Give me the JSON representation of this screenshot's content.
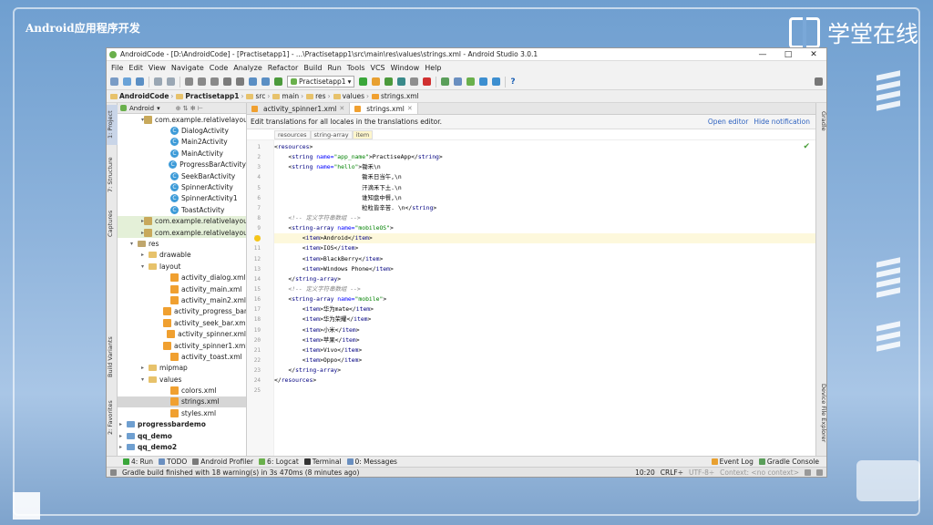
{
  "slide": {
    "title": "Android应用程序开发",
    "brand": "学堂在线"
  },
  "window": {
    "title": "AndroidCode - [D:\\AndroidCode] - [Practisetapp1] - ...\\Practisetapp1\\src\\main\\res\\values\\strings.xml - Android Studio 3.0.1",
    "minimize": "—",
    "maximize": "□",
    "close": "✕"
  },
  "menu": [
    "File",
    "Edit",
    "View",
    "Navigate",
    "Code",
    "Analyze",
    "Refactor",
    "Build",
    "Run",
    "Tools",
    "VCS",
    "Window",
    "Help"
  ],
  "toolbar": {
    "run_config": "Practisetapp1",
    "help": "?"
  },
  "breadcrumb": [
    "AndroidCode",
    "Practisetapp1",
    "src",
    "main",
    "res",
    "values",
    "strings.xml"
  ],
  "project_panel": {
    "view": "Android",
    "icons": "⊕ ⇅ ✻ ⊢"
  },
  "left_tabs": [
    "1: Project",
    "7: Structure",
    "Captures",
    "Build Variants",
    "2: Favorites"
  ],
  "right_tabs": [
    "Gradle",
    "Device File Explorer"
  ],
  "tree": [
    {
      "label": "com.example.relativelayou",
      "depth": 1,
      "kind": "pkg",
      "arrow": "▾"
    },
    {
      "label": "DialogActivity",
      "depth": 3,
      "kind": "cls"
    },
    {
      "label": "Main2Activity",
      "depth": 3,
      "kind": "cls"
    },
    {
      "label": "MainActivity",
      "depth": 3,
      "kind": "cls"
    },
    {
      "label": "ProgressBarActivity",
      "depth": 3,
      "kind": "cls"
    },
    {
      "label": "SeekBarActivity",
      "depth": 3,
      "kind": "cls"
    },
    {
      "label": "SpinnerActivity",
      "depth": 3,
      "kind": "cls"
    },
    {
      "label": "SpinnerActivity1",
      "depth": 3,
      "kind": "cls"
    },
    {
      "label": "ToastActivity",
      "depth": 3,
      "kind": "cls"
    },
    {
      "label": "com.example.relativelayou",
      "depth": 1,
      "kind": "pkg",
      "arrow": "▸",
      "hl": true
    },
    {
      "label": "com.example.relativelayou",
      "depth": 1,
      "kind": "pkg",
      "arrow": "▸",
      "hl": true
    },
    {
      "label": "res",
      "depth": 0,
      "kind": "res",
      "arrow": "▾"
    },
    {
      "label": "drawable",
      "depth": 1,
      "kind": "fld",
      "arrow": "▸"
    },
    {
      "label": "layout",
      "depth": 1,
      "kind": "fld",
      "arrow": "▾"
    },
    {
      "label": "activity_dialog.xml",
      "depth": 3,
      "kind": "xml"
    },
    {
      "label": "activity_main.xml",
      "depth": 3,
      "kind": "xml"
    },
    {
      "label": "activity_main2.xml",
      "depth": 3,
      "kind": "xml"
    },
    {
      "label": "activity_progress_bar.x",
      "depth": 3,
      "kind": "xml"
    },
    {
      "label": "activity_seek_bar.xml",
      "depth": 3,
      "kind": "xml"
    },
    {
      "label": "activity_spinner.xml",
      "depth": 3,
      "kind": "xml"
    },
    {
      "label": "activity_spinner1.xml",
      "depth": 3,
      "kind": "xml"
    },
    {
      "label": "activity_toast.xml",
      "depth": 3,
      "kind": "xml"
    },
    {
      "label": "mipmap",
      "depth": 1,
      "kind": "fld",
      "arrow": "▸"
    },
    {
      "label": "values",
      "depth": 1,
      "kind": "fld",
      "arrow": "▾"
    },
    {
      "label": "colors.xml",
      "depth": 3,
      "kind": "xml"
    },
    {
      "label": "strings.xml",
      "depth": 3,
      "kind": "xml",
      "sel": true
    },
    {
      "label": "styles.xml",
      "depth": 3,
      "kind": "xml"
    },
    {
      "label": "progressbardemo",
      "depth": -1,
      "kind": "mod",
      "arrow": "▸",
      "bold": true
    },
    {
      "label": "qq_demo",
      "depth": -1,
      "kind": "mod",
      "arrow": "▸",
      "bold": true
    },
    {
      "label": "qq_demo2",
      "depth": -1,
      "kind": "mod",
      "arrow": "▸",
      "bold": true
    }
  ],
  "editor_tabs": [
    {
      "label": "activity_spinner1.xml",
      "active": false
    },
    {
      "label": "strings.xml",
      "active": true
    }
  ],
  "notice": {
    "message": "Edit translations for all locales in the translations editor.",
    "open_editor": "Open editor",
    "hide": "Hide notification"
  },
  "xml_path": [
    "resources",
    "string-array",
    "item"
  ],
  "code_lines": [
    "<resources>",
    "    <string name=\"app_name\">PractiseApp</string>",
    "    <string name=\"hello\">锄禾\\n",
    "                         锄禾日当午,\\n",
    "                         汗滴禾下土.\\n",
    "                         谁知盘中餐,\\n",
    "                         粒粒皆辛苦. \\n</string>",
    "    <!-- 定义字符串数组 -->",
    "    <string-array name=\"mobileOS\">",
    "        <item>Android</item>",
    "        <item>IOS</item>",
    "        <item>BlackBerry</item>",
    "        <item>Windows Phone</item>",
    "    </string-array>",
    "    <!-- 定义字符串数组 -->",
    "    <string-array name=\"mobile\">",
    "        <item>华为mate</item>",
    "        <item>华为荣耀</item>",
    "        <item>小米</item>",
    "        <item>苹果</item>",
    "        <item>Vivo</item>",
    "        <item>Oppo</item>",
    "    </string-array>",
    "</resources>",
    ""
  ],
  "current_line": 10,
  "tool_windows": [
    "4: Run",
    "TODO",
    "Android Profiler",
    "6: Logcat",
    "Terminal",
    "0: Messages"
  ],
  "tool_windows_right": [
    "Event Log",
    "Gradle Console"
  ],
  "status": {
    "message": "Gradle build finished with 18 warning(s) in 3s 470ms (8 minutes ago)",
    "position": "10:20",
    "line_sep": "CRLF÷",
    "encoding": "UTF-8÷",
    "context": "Context: <no context>"
  }
}
